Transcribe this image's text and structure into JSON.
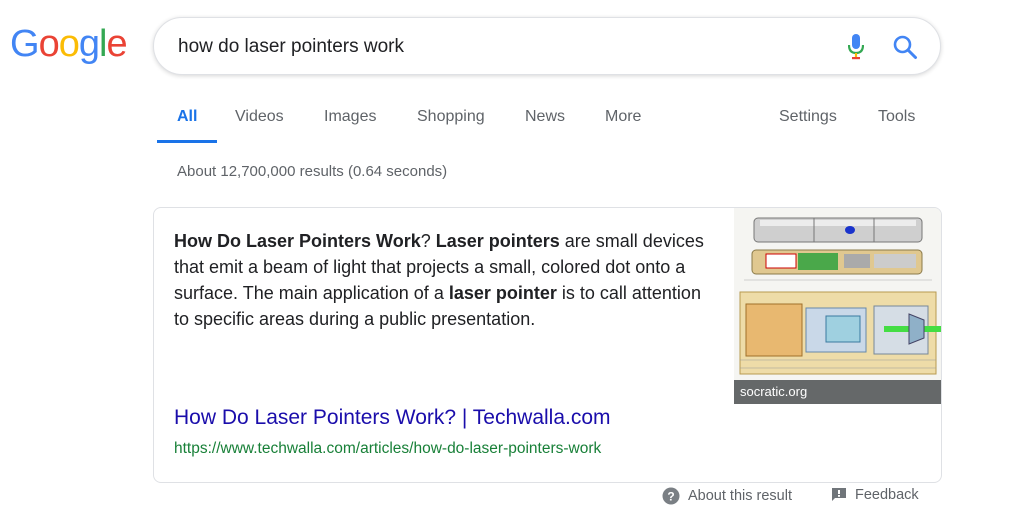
{
  "logo": {
    "letters": [
      "G",
      "o",
      "o",
      "g",
      "l",
      "e"
    ],
    "colors": [
      "#4285F4",
      "#EA4335",
      "#FBBC05",
      "#4285F4",
      "#34A853",
      "#EA4335"
    ]
  },
  "search": {
    "query": "how do laser pointers work",
    "mic_icon": "mic-icon",
    "search_icon": "search-icon"
  },
  "tabs": {
    "all": "All",
    "videos": "Videos",
    "images": "Images",
    "shopping": "Shopping",
    "news": "News",
    "more": "More",
    "settings": "Settings",
    "tools": "Tools",
    "active": "All"
  },
  "result_stats": "About 12,700,000 results (0.64 seconds)",
  "featured_snippet": {
    "segments": [
      {
        "text": "How Do Laser Pointers Work",
        "bold": true
      },
      {
        "text": "? ",
        "bold": false
      },
      {
        "text": "Laser pointers",
        "bold": true
      },
      {
        "text": " are small devices that emit a beam of light that projects a small, colored dot onto a surface. The main application of a ",
        "bold": false
      },
      {
        "text": "laser pointer",
        "bold": true
      },
      {
        "text": " is to call attention to specific areas during a public presentation.",
        "bold": false
      }
    ],
    "title": "How Do Laser Pointers Work? | Techwalla.com",
    "url": "https://www.techwalla.com/articles/how-do-laser-pointers-work",
    "image_source": "socratic.org"
  },
  "footer": {
    "about": "About this result",
    "feedback": "Feedback"
  },
  "colors": {
    "accent": "#1a73e8",
    "link": "#1a0dab",
    "url": "#188038",
    "muted": "#5f6368"
  }
}
